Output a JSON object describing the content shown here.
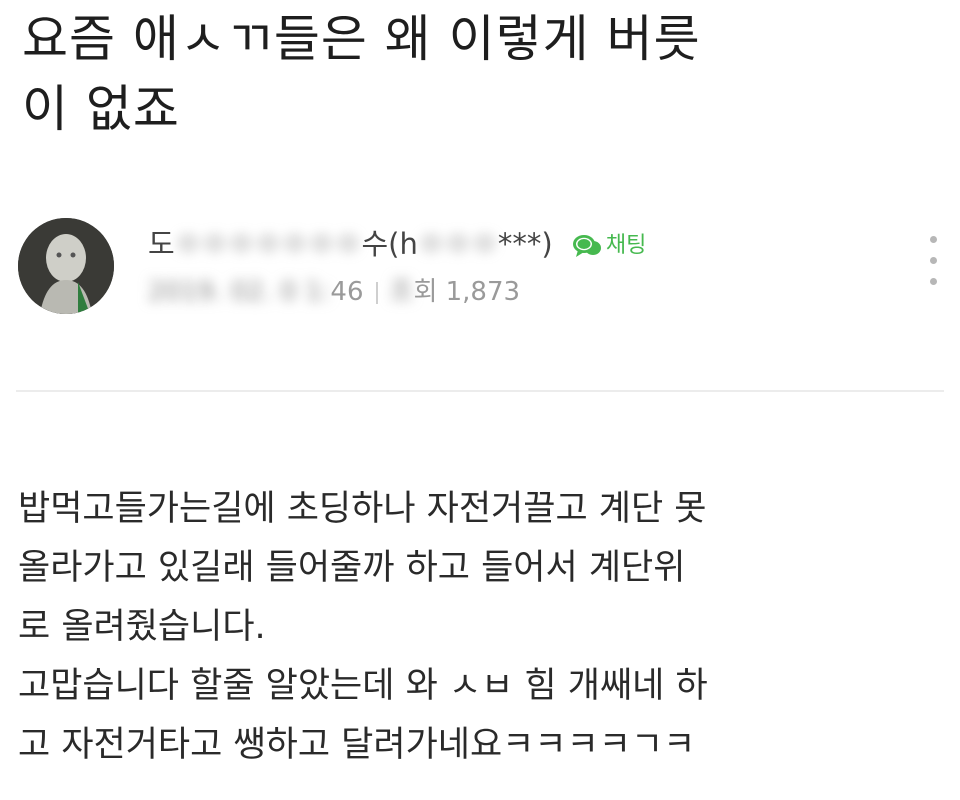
{
  "post": {
    "title_line1": "요즘 애ㅅㄲ들은 왜 이렇게 버릇",
    "title_line2": "이 없죠"
  },
  "author": {
    "name_first": "도",
    "name_hidden": "ㅇㅇㅇㅇㅇㅇㅇ",
    "name_last": "수(h",
    "id_hidden": "ㅇㅇㅇ",
    "id_suffix": "***)",
    "chat_label": "채팅",
    "chat_icon": "speech-bubble-icon"
  },
  "meta": {
    "date_hidden": "2019. 02. 0 1:",
    "date_suffix": "46",
    "views_prefix_hidden": "조",
    "views_label": "회 1,873"
  },
  "body": {
    "lines": [
      "밥먹고들가는길에 초딩하나 자전거끌고 계단 못",
      "올라가고 있길래 들어줄까 하고 들어서 계단위",
      "로 올려줬습니다.",
      "고맙습니다 할줄 알았는데 와 ㅅㅂ 힘 개쌔네 하",
      "고 자전거타고 쌩하고 달려가네요ㅋㅋㅋㅋㄱㅋ"
    ]
  },
  "colors": {
    "accent_green": "#46b94f",
    "meta_gray": "#9a9a9a"
  }
}
